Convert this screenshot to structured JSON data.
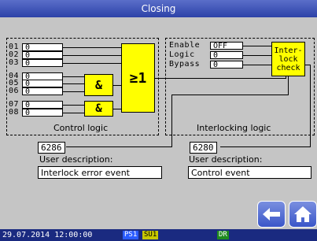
{
  "window": {
    "title": "Closing"
  },
  "control_logic": {
    "title": "Control logic",
    "inputs": [
      {
        "id": "01",
        "value": "0"
      },
      {
        "id": "02",
        "value": "0"
      },
      {
        "id": "03",
        "value": "0"
      },
      {
        "id": "04",
        "value": "0"
      },
      {
        "id": "05",
        "value": "0"
      },
      {
        "id": "06",
        "value": "0"
      },
      {
        "id": "07",
        "value": "0"
      },
      {
        "id": "08",
        "value": "0"
      }
    ],
    "and_gate_1": "&",
    "and_gate_2": "&",
    "or_gate": "≥1"
  },
  "interlocking_logic": {
    "title": "Interlocking logic",
    "enable_label": "Enable",
    "enable_value": "OFF",
    "logic_label": "Logic",
    "logic_value": "0",
    "bypass_label": "Bypass",
    "bypass_value": "0",
    "check_block": "Inter-\nlock\ncheck"
  },
  "event_left": {
    "code": "6286",
    "label": "User description:",
    "value": "Interlock error event"
  },
  "event_right": {
    "code": "6280",
    "label": "User description:",
    "value": "Control event"
  },
  "status": {
    "datetime": "29.07.2014 12:00:00",
    "badge_ps": "PS1",
    "badge_su": "SU1",
    "badge_dr": "DR",
    "colors": {
      "ps": "#2a5cff",
      "su": "#c8c800",
      "dr": "#1e8a1e"
    }
  },
  "nav": {
    "back_icon": "arrow-left-icon",
    "home_icon": "home-icon"
  }
}
